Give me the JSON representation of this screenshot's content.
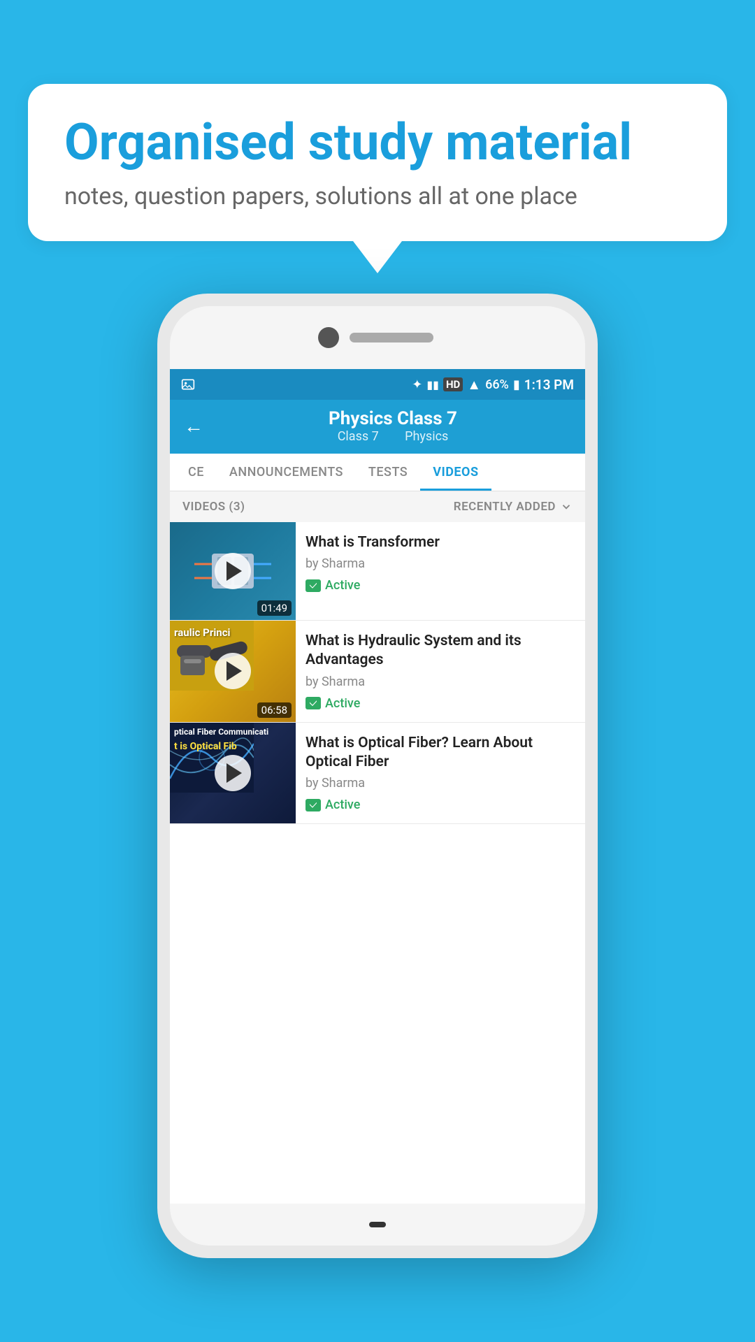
{
  "background_color": "#29b6e8",
  "speech_bubble": {
    "title": "Organised study material",
    "subtitle": "notes, question papers, solutions all at one place"
  },
  "phone": {
    "status_bar": {
      "time": "1:13 PM",
      "battery": "66%",
      "signal": "HD"
    },
    "nav": {
      "back_label": "←",
      "title": "Physics Class 7",
      "subtitle_class": "Class 7",
      "subtitle_subject": "Physics"
    },
    "tabs": [
      {
        "label": "CE",
        "active": false
      },
      {
        "label": "ANNOUNCEMENTS",
        "active": false
      },
      {
        "label": "TESTS",
        "active": false
      },
      {
        "label": "VIDEOS",
        "active": true
      }
    ],
    "filter_bar": {
      "count_label": "VIDEOS (3)",
      "sort_label": "RECENTLY ADDED",
      "sort_icon": "chevron-down"
    },
    "videos": [
      {
        "title": "What is  Transformer",
        "author": "by Sharma",
        "status": "Active",
        "duration": "01:49",
        "thumb_type": "transformer"
      },
      {
        "title": "What is Hydraulic System and its Advantages",
        "author": "by Sharma",
        "status": "Active",
        "duration": "06:58",
        "thumb_type": "hydraulic",
        "thumb_label": "raulic Princi"
      },
      {
        "title": "What is Optical Fiber? Learn About Optical Fiber",
        "author": "by Sharma",
        "status": "Active",
        "duration": "",
        "thumb_type": "optical",
        "thumb_label_top": "ptical Fiber Communicati",
        "thumb_label_bottom": "t is Optical Fib"
      }
    ]
  }
}
